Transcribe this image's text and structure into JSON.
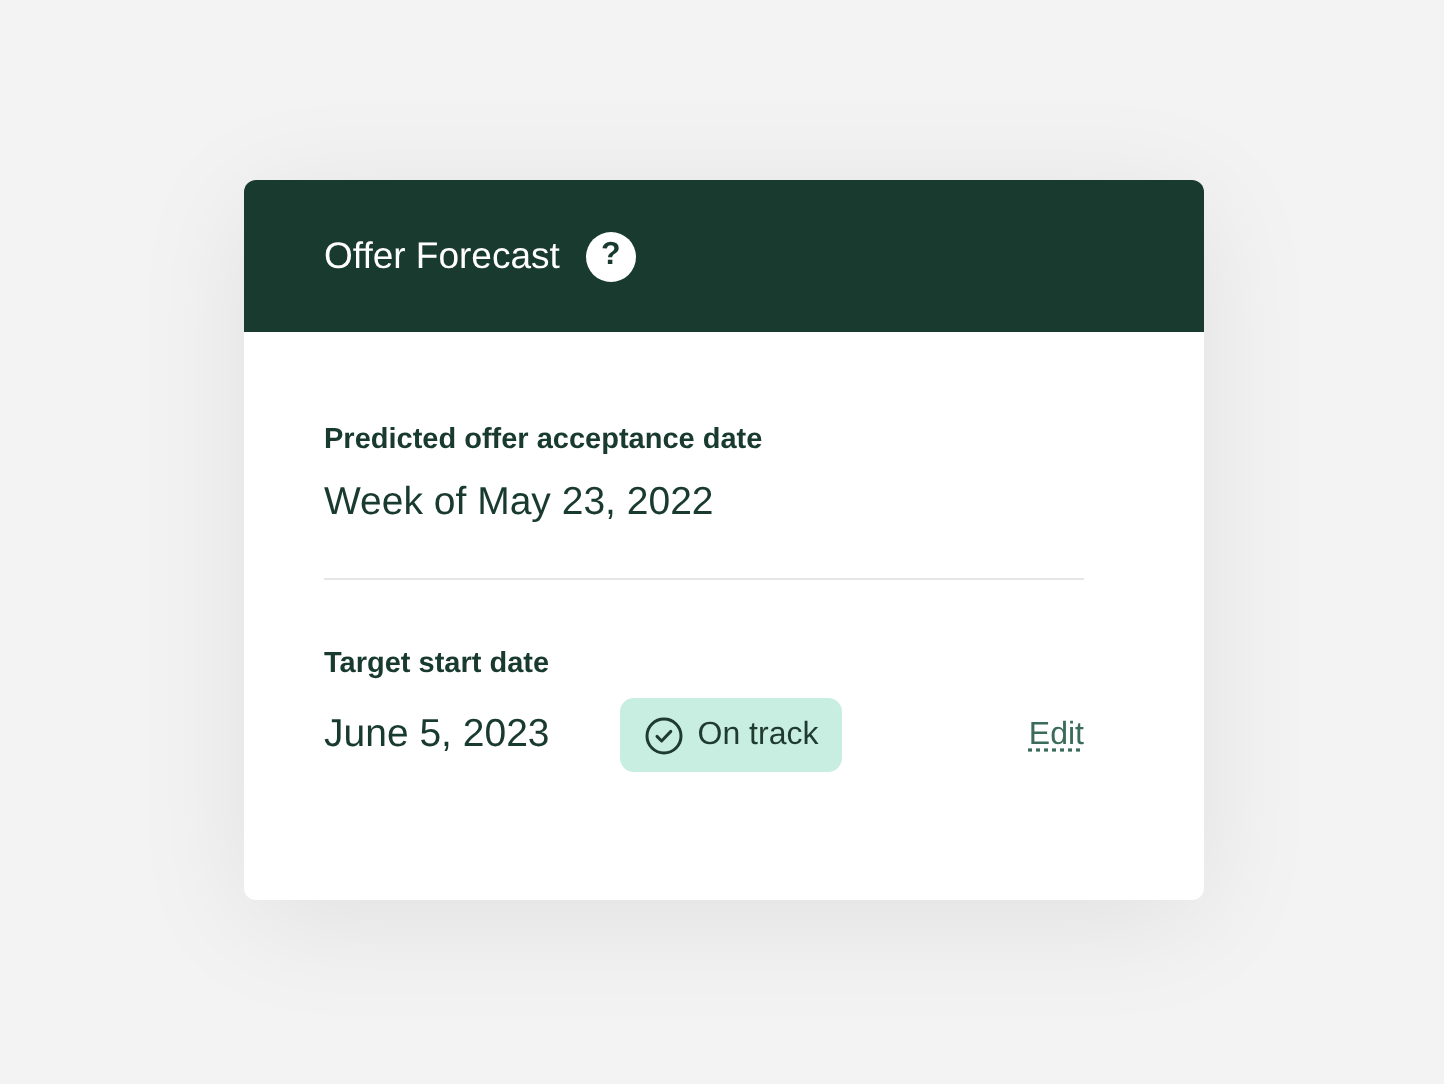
{
  "card": {
    "title": "Offer Forecast",
    "help": "?"
  },
  "sections": [
    {
      "label": "Predicted offer acceptance date",
      "value": "Week of May 23, 2022"
    },
    {
      "label": "Target start date",
      "value": "June 5, 2023",
      "status": {
        "kind": "on_track",
        "label": "On track"
      },
      "action": "Edit"
    }
  ]
}
